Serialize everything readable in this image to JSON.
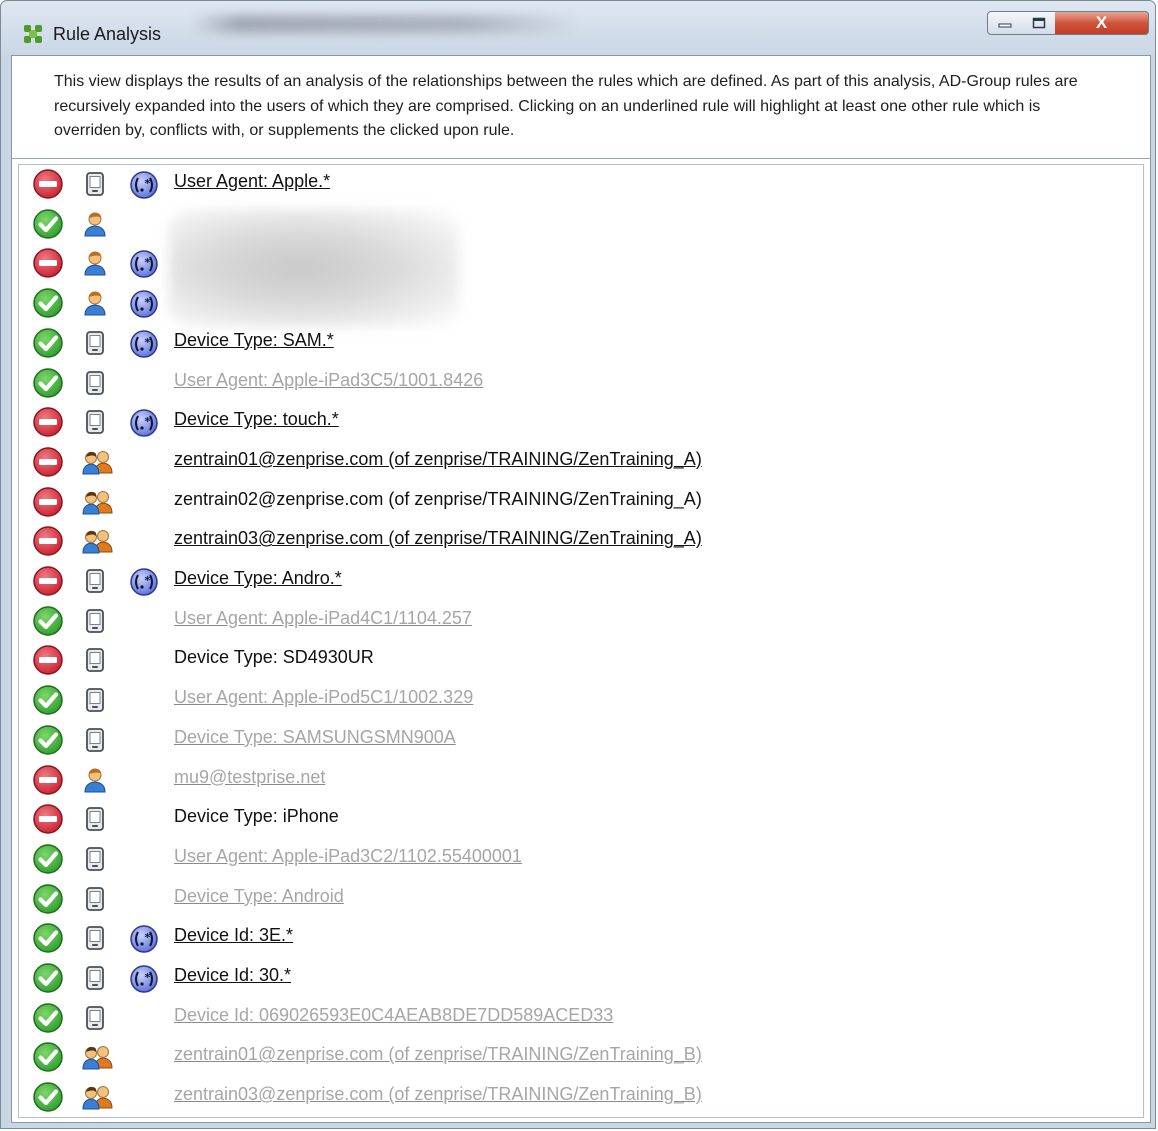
{
  "window": {
    "title": "Rule Analysis",
    "close_glyph": "X"
  },
  "description": "This view displays the results of an analysis of the relationships between the rules which are defined. As part of this analysis, AD-Group rules are recursively expanded into the users of which they are comprised. Clicking on an underlined rule will highlight at least one other rule which is overriden by, conflicts with, or supplements the clicked upon rule.",
  "rules": [
    {
      "status": "deny",
      "type": "device",
      "regex": true,
      "label": "User Agent: Apple.*",
      "style": "active"
    },
    {
      "status": "allow",
      "type": "user",
      "regex": false,
      "label": "",
      "style": "hidden"
    },
    {
      "status": "deny",
      "type": "user",
      "regex": true,
      "label": "",
      "style": "hidden"
    },
    {
      "status": "allow",
      "type": "user",
      "regex": true,
      "label": "",
      "style": "hidden"
    },
    {
      "status": "allow",
      "type": "device",
      "regex": true,
      "label": "Device Type: SAM.*",
      "style": "active"
    },
    {
      "status": "allow",
      "type": "device",
      "regex": false,
      "label": "User Agent: Apple-iPad3C5/1001.8426",
      "style": "dim"
    },
    {
      "status": "deny",
      "type": "device",
      "regex": true,
      "label": "Device Type: touch.*",
      "style": "active"
    },
    {
      "status": "deny",
      "type": "group",
      "regex": false,
      "label": "zentrain01@zenprise.com (of zenprise/TRAINING/ZenTraining_A)",
      "style": "active"
    },
    {
      "status": "deny",
      "type": "group",
      "regex": false,
      "label": "zentrain02@zenprise.com (of zenprise/TRAINING/ZenTraining_A)",
      "style": "plain"
    },
    {
      "status": "deny",
      "type": "group",
      "regex": false,
      "label": "zentrain03@zenprise.com (of zenprise/TRAINING/ZenTraining_A)",
      "style": "active"
    },
    {
      "status": "deny",
      "type": "device",
      "regex": true,
      "label": "Device Type: Andro.*",
      "style": "active"
    },
    {
      "status": "allow",
      "type": "device",
      "regex": false,
      "label": "User Agent: Apple-iPad4C1/1104.257",
      "style": "dim"
    },
    {
      "status": "deny",
      "type": "device",
      "regex": false,
      "label": "Device Type: SD4930UR",
      "style": "plain"
    },
    {
      "status": "allow",
      "type": "device",
      "regex": false,
      "label": "User Agent: Apple-iPod5C1/1002.329",
      "style": "dim"
    },
    {
      "status": "allow",
      "type": "device",
      "regex": false,
      "label": "Device Type: SAMSUNGSMN900A",
      "style": "dim"
    },
    {
      "status": "deny",
      "type": "user",
      "regex": false,
      "label": "mu9@testprise.net",
      "style": "dim"
    },
    {
      "status": "deny",
      "type": "device",
      "regex": false,
      "label": "Device Type: iPhone",
      "style": "plain"
    },
    {
      "status": "allow",
      "type": "device",
      "regex": false,
      "label": "User Agent: Apple-iPad3C2/1102.55400001",
      "style": "dim"
    },
    {
      "status": "allow",
      "type": "device",
      "regex": false,
      "label": "Device Type: Android",
      "style": "dim"
    },
    {
      "status": "allow",
      "type": "device",
      "regex": true,
      "label": "Device Id: 3E.*",
      "style": "active"
    },
    {
      "status": "allow",
      "type": "device",
      "regex": true,
      "label": "Device Id: 30.*",
      "style": "active"
    },
    {
      "status": "allow",
      "type": "device",
      "regex": false,
      "label": "Device Id: 069026593E0C4AEAB8DE7DD589ACED33",
      "style": "dim"
    },
    {
      "status": "allow",
      "type": "group",
      "regex": false,
      "label": "zentrain01@zenprise.com (of zenprise/TRAINING/ZenTraining_B)",
      "style": "dim"
    },
    {
      "status": "allow",
      "type": "group",
      "regex": false,
      "label": "zentrain03@zenprise.com (of zenprise/TRAINING/ZenTraining_B)",
      "style": "dim"
    }
  ],
  "icons": {
    "allow": "allow-check-icon",
    "deny": "deny-stop-icon",
    "device": "device-icon",
    "user": "user-icon",
    "group": "user-group-icon",
    "regex": "regex-icon"
  },
  "colors": {
    "allow": "#2f9e2f",
    "deny": "#c8202f",
    "dim_text": "#a6a6a6",
    "regex": "#5b6fd6"
  }
}
